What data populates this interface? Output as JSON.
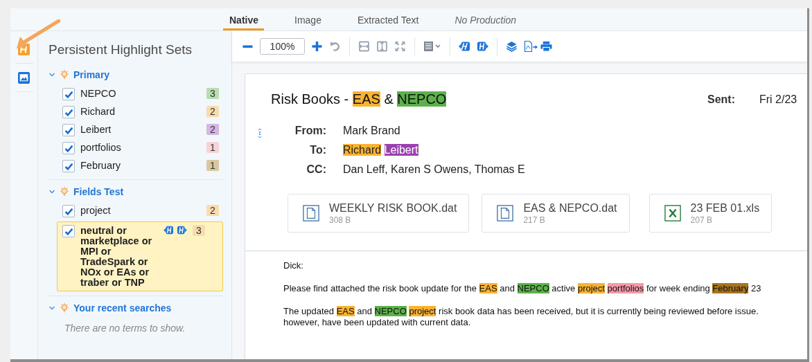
{
  "tabs": [
    {
      "label": "Native",
      "selected": true,
      "disabled": false
    },
    {
      "label": "Image",
      "selected": false,
      "disabled": false
    },
    {
      "label": "Extracted Text",
      "selected": false,
      "disabled": false
    },
    {
      "label": "No Production",
      "selected": false,
      "disabled": true
    }
  ],
  "toolbar": {
    "zoom": "100%"
  },
  "sidebar": {
    "title": "Persistent Highlight Sets",
    "groups": [
      {
        "name": "Primary",
        "expanded": true,
        "terms": [
          {
            "label": "NEPCO",
            "checked": true,
            "selected": false,
            "count": "3",
            "color": "#b9dcb2"
          },
          {
            "label": "Richard",
            "checked": true,
            "selected": false,
            "count": "2",
            "color": "#f7dcae"
          },
          {
            "label": "Leibert",
            "checked": true,
            "selected": false,
            "count": "2",
            "color": "#d4b5e3"
          },
          {
            "label": "portfolios",
            "checked": true,
            "selected": false,
            "count": "1",
            "color": "#f6d3d9"
          },
          {
            "label": "February",
            "checked": true,
            "selected": false,
            "count": "1",
            "color": "#d9c79e"
          }
        ]
      },
      {
        "name": "Fields Test",
        "expanded": true,
        "terms": [
          {
            "label": "project",
            "checked": true,
            "selected": false,
            "count": "2",
            "color": "#f7dcae"
          },
          {
            "label": "neutral or marketplace or MPI or TradeSpark or NOx or EAs or traber or TNP",
            "checked": true,
            "selected": true,
            "count": "3",
            "color": "#f7dcae"
          }
        ]
      },
      {
        "name": "Your recent searches",
        "expanded": true,
        "empty_text": "There are no terms to show."
      }
    ]
  },
  "document": {
    "subject": [
      {
        "text": "Risk Books - "
      },
      {
        "text": "EAS",
        "color": "#f9b233"
      },
      {
        "text": " & "
      },
      {
        "text": "NEPCO",
        "color": "#5db14b"
      }
    ],
    "sent_label": "Sent:",
    "sent_value": "Fri 2/23",
    "fields": [
      {
        "label": "From:",
        "value": [
          {
            "text": "Mark Brand"
          }
        ]
      },
      {
        "label": "To:",
        "value": [
          {
            "text": "Richard",
            "color": "#f9b233"
          },
          {
            "text": "Leibert",
            "color": "#9b3fb0"
          }
        ]
      },
      {
        "label": "CC:",
        "value": [
          {
            "text": "Dan Leff, Karen S Owens, Thomas E"
          }
        ]
      }
    ],
    "attachments": [
      {
        "name": "WEEKLY RISK BOOK.dat",
        "size": "308 B",
        "kind": "file"
      },
      {
        "name": "EAS & NEPCO.dat",
        "size": "217 B",
        "kind": "file"
      },
      {
        "name": "23 FEB 01.xls",
        "size": "207 B",
        "kind": "excel"
      }
    ],
    "body": [
      {
        "lines": [
          [
            {
              "text": "Dick:"
            }
          ]
        ]
      },
      {
        "lines": [
          [
            {
              "text": "Please find attached the risk book update for the "
            },
            {
              "text": "EAS",
              "color": "#f9b233"
            },
            {
              "text": " and "
            },
            {
              "text": "NEPCO",
              "color": "#5db14b"
            },
            {
              "text": " active "
            },
            {
              "text": "project",
              "color": "#f9b233"
            },
            {
              "text": "portfolios",
              "color": "#f29aa8"
            },
            {
              "text": " for week ending "
            },
            {
              "text": "February",
              "color": "#a87420"
            },
            {
              "text": " 23"
            }
          ]
        ]
      },
      {
        "lines": [
          [
            {
              "text": "The updated "
            },
            {
              "text": "EAS",
              "color": "#f9b233"
            },
            {
              "text": " and "
            },
            {
              "text": "NEPCO",
              "color": "#5db14b"
            },
            {
              "text": "project",
              "color": "#f9b233"
            },
            {
              "text": " risk book data has been received, but it is currently being reviewed before issue."
            }
          ],
          [
            {
              "text": "however, have been updated with current data."
            }
          ]
        ]
      }
    ]
  }
}
